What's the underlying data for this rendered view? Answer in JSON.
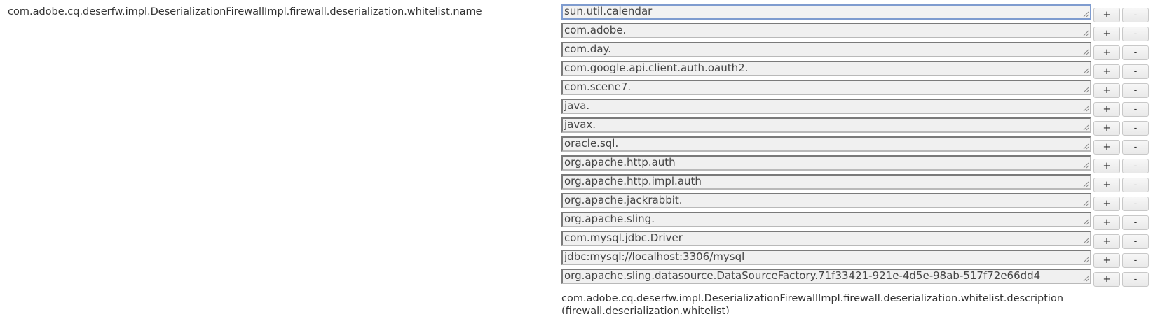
{
  "property": {
    "name": "com.adobe.cq.deserfw.impl.DeserializationFirewallImpl.firewall.deserialization.whitelist.name",
    "description": "com.adobe.cq.deserfw.impl.DeserializationFirewallImpl.firewall.deserialization.whitelist.description",
    "description_sub": "(firewall.deserialization.whitelist)"
  },
  "buttons": {
    "add_label": "+",
    "remove_label": "-"
  },
  "values": [
    "sun.util.calendar",
    "com.adobe.",
    "com.day.",
    "com.google.api.client.auth.oauth2.",
    "com.scene7.",
    "java.",
    "javax.",
    "oracle.sql.",
    "org.apache.http.auth",
    "org.apache.http.impl.auth",
    "org.apache.jackrabbit.",
    "org.apache.sling.",
    "com.mysql.jdbc.Driver",
    "jdbc:mysql://localhost:3306/mysql",
    "org.apache.sling.datasource.DataSourceFactory.71f33421-921e-4d5e-98ab-517f72e66dd4"
  ],
  "colors": {
    "focus_border": "#7f9ccf",
    "field_background": "#f0f0f0",
    "text": "#333333"
  }
}
